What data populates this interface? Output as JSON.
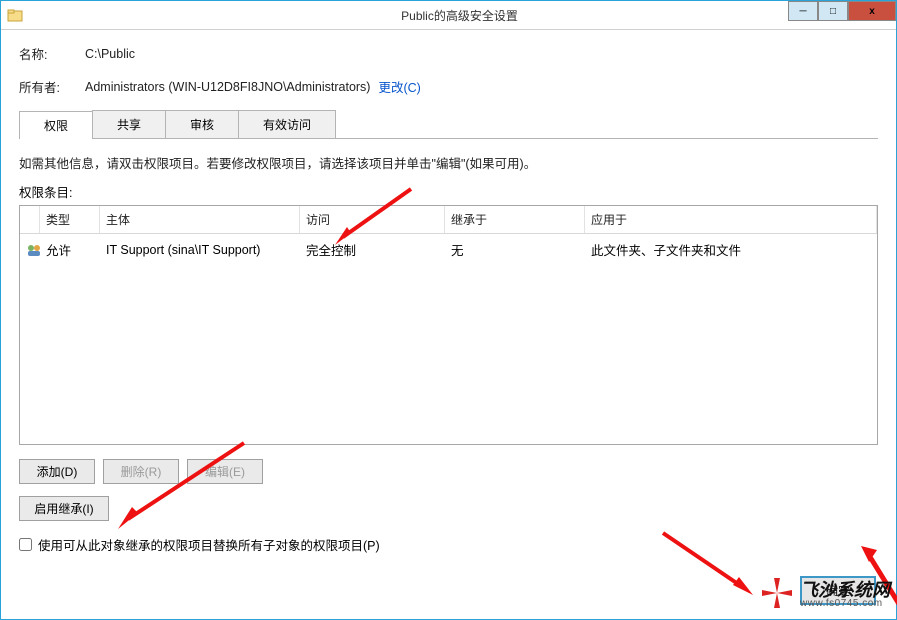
{
  "window": {
    "title": "Public的高级安全设置",
    "min_label": "─",
    "max_label": "□",
    "close_label": "x"
  },
  "header": {
    "name_label": "名称:",
    "name_value": "C:\\Public",
    "owner_label": "所有者:",
    "owner_value": "Administrators (WIN-U12D8FI8JNO\\Administrators)",
    "change_link": "更改(C)"
  },
  "tabs": [
    "权限",
    "共享",
    "审核",
    "有效访问"
  ],
  "instruction": "如需其他信息，请双击权限项目。若要修改权限项目，请选择该项目并单击\"编辑\"(如果可用)。",
  "list_label": "权限条目:",
  "columns": {
    "blank": "",
    "type": "类型",
    "principal": "主体",
    "access": "访问",
    "inherited": "继承于",
    "applies": "应用于"
  },
  "rows": [
    {
      "type": "允许",
      "principal": "IT Support (sina\\IT Support)",
      "access": "完全控制",
      "inherited": "无",
      "applies": "此文件夹、子文件夹和文件"
    }
  ],
  "buttons": {
    "add": "添加(D)",
    "remove": "删除(R)",
    "edit": "编辑(E)",
    "enable_inherit": "启用继承(I)"
  },
  "checkbox_label": "使用可从此对象继承的权限项目替换所有子对象的权限项目(P)",
  "dlg": {
    "ok": "确定"
  },
  "watermark": {
    "main": "飞沙系统网",
    "sub": "www.fs0745.com"
  }
}
